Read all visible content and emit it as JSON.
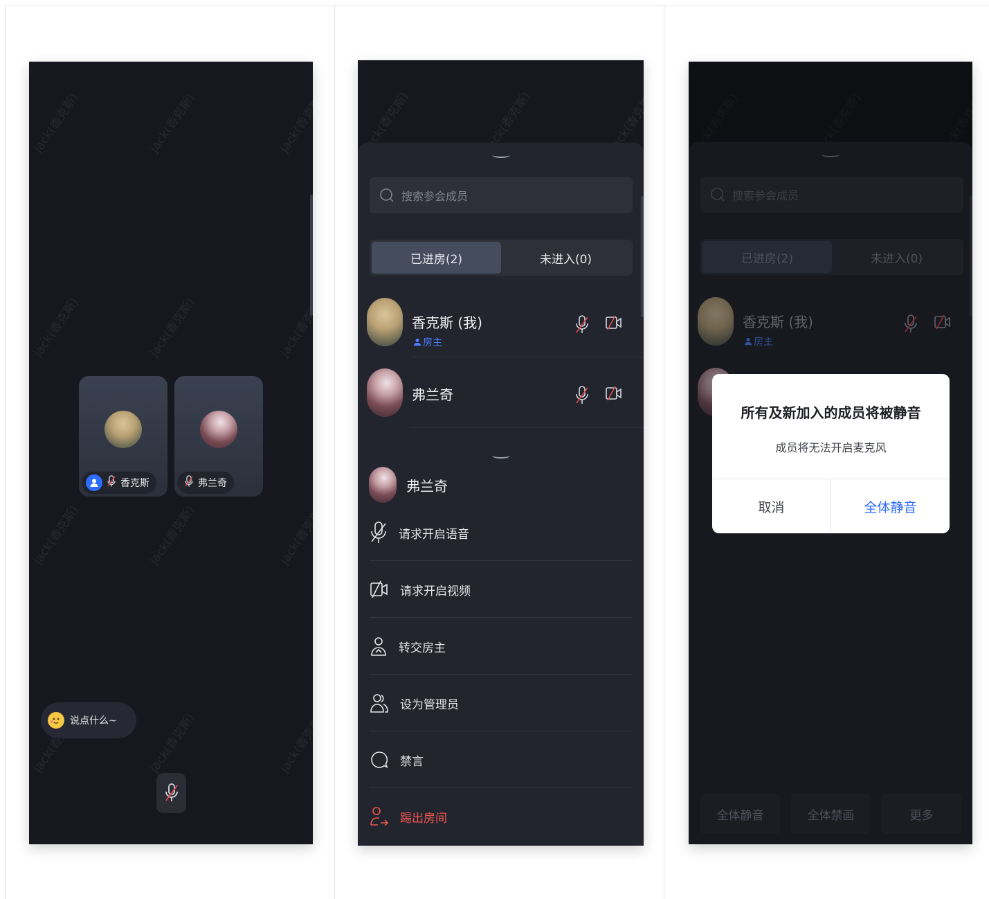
{
  "watermark": "jack(香克斯)",
  "screen1": {
    "tiles": [
      {
        "name": "香克斯",
        "is_host": true
      },
      {
        "name": "弗兰奇",
        "is_host": false
      }
    ],
    "chat_placeholder": "说点什么~"
  },
  "screen2": {
    "search_placeholder": "搜索参会成员",
    "tabs": {
      "entered": "已进房(2)",
      "not_entered": "未进入(0)"
    },
    "members": [
      {
        "name": "香克斯 (我)",
        "role": "房主"
      },
      {
        "name": "弗兰奇",
        "role": ""
      }
    ],
    "panel": {
      "member_name": "弗兰奇",
      "actions": {
        "request_audio": "请求开启语音",
        "request_video": "请求开启视频",
        "transfer_host": "转交房主",
        "set_admin": "设为管理员",
        "mute_chat": "禁言",
        "kick_out": "踢出房间"
      }
    }
  },
  "screen3": {
    "search_placeholder": "搜索参会成员",
    "tabs": {
      "entered": "已进房(2)",
      "not_entered": "未进入(0)"
    },
    "member_name": "香克斯 (我)",
    "member_role": "房主",
    "dialog": {
      "title": "所有及新加入的成员将被静音",
      "message": "成员将无法开启麦克风",
      "cancel": "取消",
      "confirm": "全体静音"
    },
    "bottom_buttons": {
      "mute_all": "全体静音",
      "ban_all_video": "全体禁画",
      "more": "更多"
    }
  },
  "colors": {
    "accent": "#2e6bff",
    "danger": "#f0564f",
    "background": "#17181f",
    "sheet": "#22252e"
  }
}
